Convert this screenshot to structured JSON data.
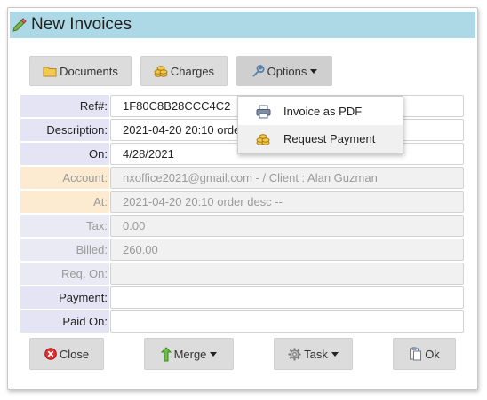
{
  "dialog": {
    "title": "New Invoices",
    "title_icon": "pencil-icon"
  },
  "toolbar": {
    "documents_label": "Documents",
    "charges_label": "Charges",
    "options_label": "Options"
  },
  "options_menu": {
    "items": [
      {
        "label": "Invoice as PDF",
        "icon": "printer-icon"
      },
      {
        "label": "Request Payment",
        "icon": "coins-icon"
      }
    ]
  },
  "form": {
    "ref": {
      "label": "Ref#:",
      "value": "1F80C8B28CCC4C2"
    },
    "description": {
      "label": "Description:",
      "value": "2021-04-20 20:10 order desc --"
    },
    "on": {
      "label": "On:",
      "value": "4/28/2021"
    },
    "account": {
      "label": "Account:",
      "value": "nxoffice2021@gmail.com -  / Client : Alan Guzman"
    },
    "at": {
      "label": "At:",
      "value": "2021-04-20 20:10 order desc --"
    },
    "tax": {
      "label": "Tax:",
      "value": "0.00"
    },
    "billed": {
      "label": "Billed:",
      "value": "260.00"
    },
    "req_on": {
      "label": "Req. On:",
      "value": ""
    },
    "payment": {
      "label": "Payment:",
      "value": ""
    },
    "paid_on": {
      "label": "Paid On:",
      "value": ""
    }
  },
  "footer": {
    "close_label": "Close",
    "merge_label": "Merge",
    "task_label": "Task",
    "ok_label": "Ok"
  },
  "colors": {
    "titlebar": "#add8e6",
    "label_bg": "#e4e4f4",
    "label_orange_bg": "#fdebd1",
    "button_bg": "#dcdcdc"
  }
}
